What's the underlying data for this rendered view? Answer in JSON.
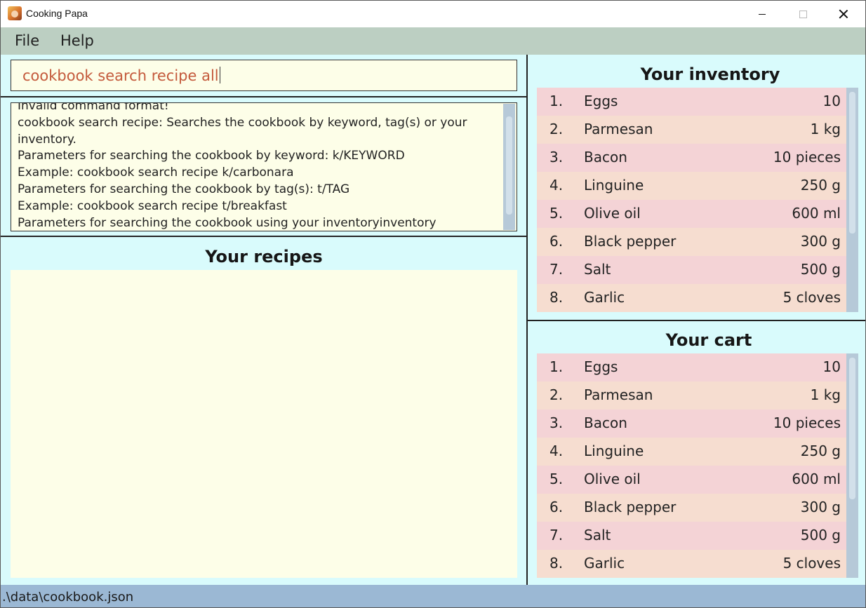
{
  "window": {
    "title": "Cooking Papa"
  },
  "menu": {
    "file": "File",
    "help": "Help"
  },
  "command": {
    "value": "cookbook search recipe all"
  },
  "result": {
    "lines": [
      "Invalid command format!",
      "cookbook search recipe: Searches the cookbook by keyword, tag(s) or your",
      "inventory.",
      "Parameters for searching the cookbook by keyword: k/KEYWORD",
      "Example: cookbook search recipe k/carbonara",
      "Parameters for searching the cookbook by tag(s): t/TAG",
      "Example: cookbook search recipe t/breakfast",
      "Parameters for searching the cookbook using your inventoryinventory"
    ]
  },
  "recipes": {
    "title": "Your recipes"
  },
  "inventory": {
    "title": "Your inventory",
    "items": [
      {
        "index": "1.",
        "name": "Eggs",
        "qty": "10"
      },
      {
        "index": "2.",
        "name": "Parmesan",
        "qty": "1 kg"
      },
      {
        "index": "3.",
        "name": "Bacon",
        "qty": "10 pieces"
      },
      {
        "index": "4.",
        "name": "Linguine",
        "qty": "250 g"
      },
      {
        "index": "5.",
        "name": "Olive oil",
        "qty": "600 ml"
      },
      {
        "index": "6.",
        "name": "Black pepper",
        "qty": "300 g"
      },
      {
        "index": "7.",
        "name": "Salt",
        "qty": "500 g"
      },
      {
        "index": "8.",
        "name": "Garlic",
        "qty": "5 cloves"
      }
    ]
  },
  "cart": {
    "title": "Your cart",
    "items": [
      {
        "index": "1.",
        "name": "Eggs",
        "qty": "10"
      },
      {
        "index": "2.",
        "name": "Parmesan",
        "qty": "1 kg"
      },
      {
        "index": "3.",
        "name": "Bacon",
        "qty": "10 pieces"
      },
      {
        "index": "4.",
        "name": "Linguine",
        "qty": "250 g"
      },
      {
        "index": "5.",
        "name": "Olive oil",
        "qty": "600 ml"
      },
      {
        "index": "6.",
        "name": "Black pepper",
        "qty": "300 g"
      },
      {
        "index": "7.",
        "name": "Salt",
        "qty": "500 g"
      },
      {
        "index": "8.",
        "name": "Garlic",
        "qty": "5 cloves"
      }
    ]
  },
  "status": {
    "path": ".\\data\\cookbook.json"
  },
  "colors": {
    "menubar": "#bccfc2",
    "panel": "#d9fbfc",
    "textbox": "#fdfee8",
    "row_odd": "#f4d3d6",
    "row_even": "#f6ddd0",
    "command_text": "#c45a3c",
    "statusbar": "#9bb8d4"
  }
}
